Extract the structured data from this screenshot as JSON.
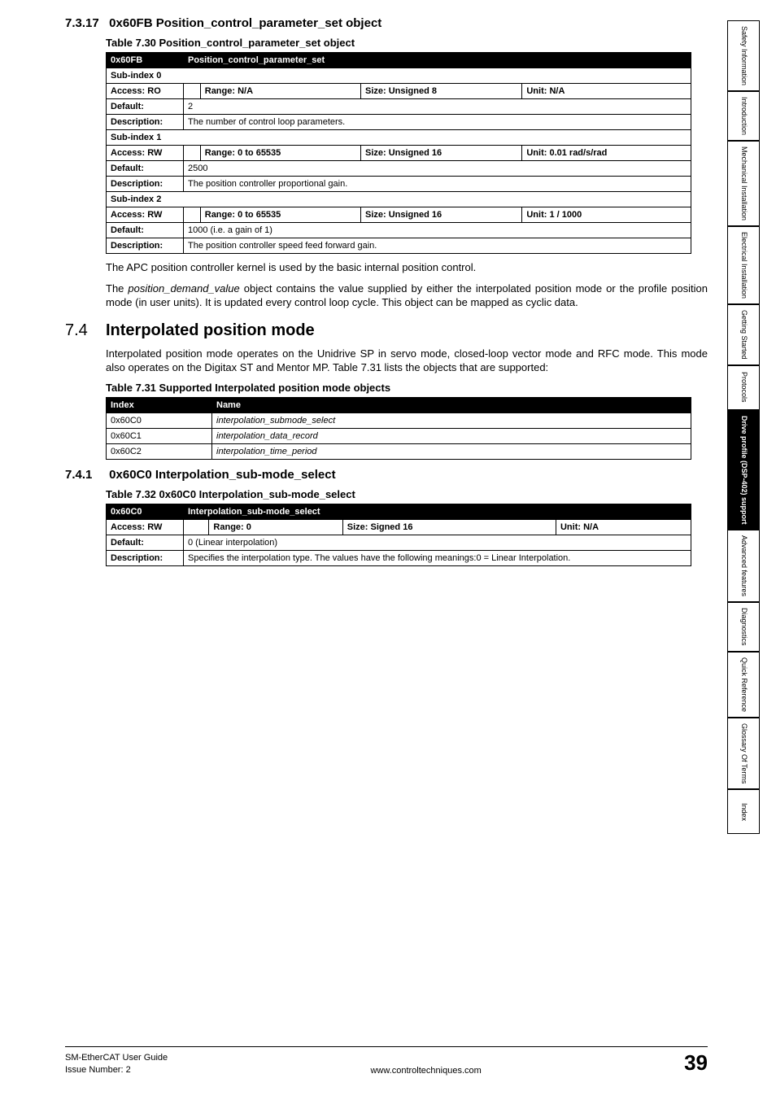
{
  "sections": {
    "s7317": {
      "num": "7.3.17",
      "title": "0x60FB Position_control_parameter_set object",
      "caption": "Table 7.30  Position_control_parameter_set object",
      "table": {
        "header_code": "0x60FB",
        "header_name": "Position_control_parameter_set",
        "subs": [
          {
            "sub": "Sub-index 0",
            "access": "Access: RO",
            "range": "Range: N/A",
            "size": "Size: Unsigned 8",
            "unit": "Unit: N/A",
            "default_lab": "Default:",
            "default": "2",
            "desc_lab": "Description:",
            "desc": "The number of control loop parameters."
          },
          {
            "sub": "Sub-index 1",
            "access": "Access: RW",
            "range": "Range: 0 to 65535",
            "size": "Size: Unsigned 16",
            "unit": "Unit: 0.01 rad/s/rad",
            "default_lab": "Default:",
            "default": "2500",
            "desc_lab": "Description:",
            "desc": "The position controller proportional gain."
          },
          {
            "sub": "Sub-index 2",
            "access": "Access: RW",
            "range": "Range: 0 to 65535",
            "size": "Size: Unsigned 16",
            "unit": "Unit: 1 / 1000",
            "default_lab": "Default:",
            "default": "1000 (i.e. a gain of 1)",
            "desc_lab": "Description:",
            "desc": "The position controller speed feed forward gain."
          }
        ]
      },
      "para1": "The APC position controller kernel is used by the basic internal position control.",
      "para2a": "The ",
      "para2b": "position_demand_value",
      "para2c": " object contains the value supplied by either the interpolated position mode or the profile position mode (in user units). It is updated every control loop cycle. This object can be mapped as cyclic data."
    },
    "s74": {
      "num": "7.4",
      "title": "Interpolated position mode",
      "para": "Interpolated position mode operates on the Unidrive SP in servo mode, closed-loop vector mode and RFC mode. This mode also operates on the Digitax ST and Mentor MP. Table 7.31 lists the objects that are supported:",
      "caption": "Table 7.31  Supported Interpolated position mode objects",
      "table": {
        "th1": "Index",
        "th2": "Name",
        "rows": [
          {
            "idx": "0x60C0",
            "name": "interpolation_submode_select"
          },
          {
            "idx": "0x60C1",
            "name": "interpolation_data_record"
          },
          {
            "idx": "0x60C2",
            "name": "interpolation_time_period"
          }
        ]
      }
    },
    "s741": {
      "num": "7.4.1",
      "title": "0x60C0 Interpolation_sub-mode_select",
      "caption": "Table 7.32  0x60C0 Interpolation_sub-mode_select",
      "table": {
        "header_code": "0x60C0",
        "header_name": "Interpolation_sub-mode_select",
        "access": "Access: RW",
        "range": "Range: 0",
        "size": "Size: Signed 16",
        "unit": "Unit: N/A",
        "default_lab": "Default:",
        "default": "0 (Linear interpolation)",
        "desc_lab": "Description:",
        "desc": "Specifies the interpolation type. The values have the following meanings:0 = Linear Interpolation."
      }
    }
  },
  "sidebar": [
    "Safety Information",
    "Introduction",
    "Mechanical Installation",
    "Electrical Installation",
    "Getting Started",
    "Protocols",
    "Drive profile (DSP-402) support",
    "Advanced features",
    "Diagnostics",
    "Quick Reference",
    "Glossary Of Terms",
    "Index"
  ],
  "sidebar_active_index": 6,
  "footer": {
    "title": "SM-EtherCAT User Guide",
    "issue": "Issue Number:  2",
    "url": "www.controltechniques.com",
    "page": "39"
  }
}
